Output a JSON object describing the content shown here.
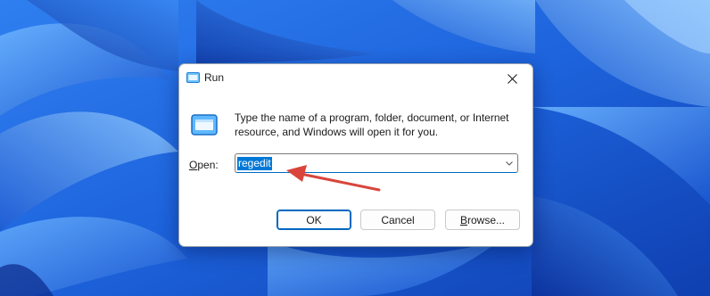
{
  "desktop": {
    "wallpaper": "windows-11-bloom-blue"
  },
  "dialog": {
    "title": "Run",
    "title_icon": "run-icon",
    "close_icon": "close-icon",
    "app_icon": "run-icon",
    "description": "Type the name of a program, folder, document, or Internet resource, and Windows will open it for you.",
    "open_label_accel": "O",
    "open_label_rest": "pen:",
    "combo_value": "regedit",
    "combo_arrow_icon": "chevron-down-icon",
    "buttons": {
      "ok": "OK",
      "cancel": "Cancel",
      "browse_accel": "B",
      "browse_rest": "rowse..."
    }
  },
  "annotation": {
    "arrow_color": "#d9453b",
    "points_to": "combo_value"
  },
  "colors": {
    "accent": "#0078d7",
    "selection": "#0078d7"
  }
}
